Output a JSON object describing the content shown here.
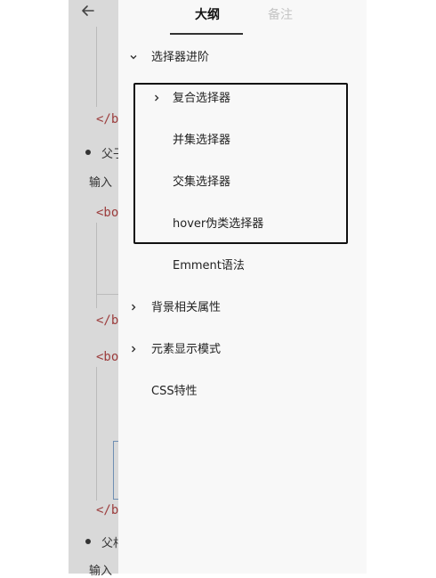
{
  "tabs": {
    "outline": "大纲",
    "notes": "备注"
  },
  "outline": {
    "items": [
      {
        "label": "选择器进阶",
        "expanded": true
      },
      {
        "label": "复合选择器",
        "expanded": false
      },
      {
        "label": "并集选择器"
      },
      {
        "label": "交集选择器"
      },
      {
        "label": "hover伪类选择器"
      },
      {
        "label": "Emment语法"
      },
      {
        "label": "背景相关属性",
        "expanded": false
      },
      {
        "label": "元素显示模式",
        "expanded": false
      },
      {
        "label": "CSS特性"
      }
    ]
  },
  "background_doc": {
    "code_tag_1": "</b",
    "bullet_1_text": "父子",
    "input_label_1": "输入",
    "code_tag_2": "<bod",
    "code_tag_3": "</b",
    "code_tag_4": "<bod",
    "code_tag_5": "</b",
    "bullet_2_text": "父相",
    "input_label_2": "输入"
  },
  "icons": {
    "back": "arrow-left-icon",
    "expanded": "chevron-down-icon",
    "collapsed": "chevron-right-icon"
  },
  "colors": {
    "panel_bg": "#f8f8f8",
    "dim_bg": "#d9d9d9",
    "highlight_border": "#111111",
    "inactive_tab": "#c4c4c4"
  }
}
